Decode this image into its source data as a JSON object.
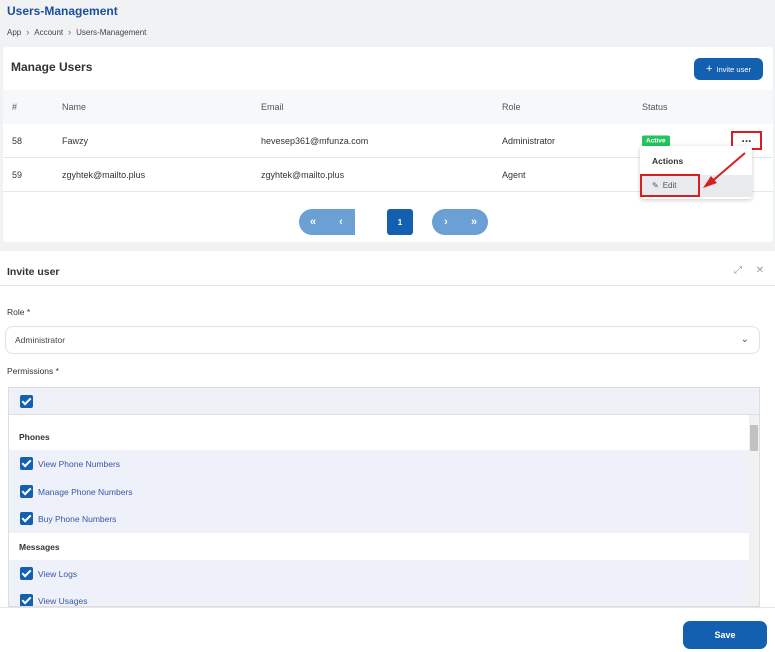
{
  "header": {
    "title": "Users-Management",
    "breadcrumb": [
      "App",
      "Account",
      "Users-Management"
    ]
  },
  "users_card": {
    "title": "Manage Users",
    "invite_label": "Invite user",
    "columns": [
      "#",
      "Name",
      "Email",
      "Role",
      "Status"
    ],
    "rows": [
      {
        "id": "58",
        "name": "Fawzy",
        "email": "hevesep361@mfunza.com",
        "role": "Administrator",
        "status": "Active",
        "actions": "..."
      },
      {
        "id": "59",
        "name": "zgyhtek@mailto.plus",
        "email": "zgyhtek@mailto.plus",
        "role": "Agent",
        "status": "",
        "actions": ""
      }
    ],
    "pagination": {
      "first": "«",
      "prev": "‹",
      "current": "1",
      "next": "›",
      "last": "»"
    },
    "actions_menu": {
      "title": "Actions",
      "edit_label": "Edit"
    }
  },
  "invite_panel": {
    "title": "Invite user",
    "role_label": "Role *",
    "role_value": "Administrator",
    "permissions_label": "Permissions *",
    "groups": [
      {
        "name": "Phones",
        "items": [
          "View Phone Numbers",
          "Manage Phone Numbers",
          "Buy Phone Numbers"
        ]
      },
      {
        "name": "Messages",
        "items": [
          "View Logs",
          "View Usages"
        ]
      }
    ],
    "save_label": "Save"
  },
  "colors": {
    "primary": "#1360b0",
    "active": "#22c55e",
    "highlight": "#d71f1f"
  }
}
